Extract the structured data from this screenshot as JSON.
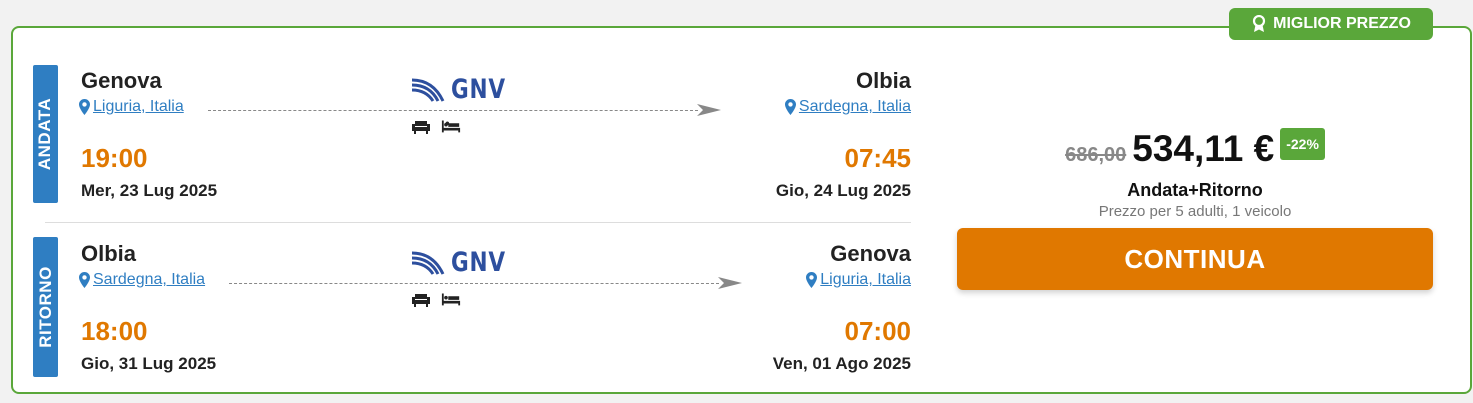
{
  "badge": {
    "label": "MIGLIOR PREZZO",
    "icon": "award-ribbon-icon"
  },
  "legs": [
    {
      "tag": "ANDATA",
      "from": {
        "city": "Genova",
        "region": "Liguria, Italia",
        "time": "19:00",
        "date": "Mer, 23 Lug 2025"
      },
      "to": {
        "city": "Olbia",
        "region": "Sardegna, Italia",
        "time": "07:45",
        "date": "Gio, 24 Lug 2025"
      },
      "operator": "GNV",
      "amenities": [
        "armchair-icon",
        "bed-icon"
      ]
    },
    {
      "tag": "RITORNO",
      "from": {
        "city": "Olbia",
        "region": "Sardegna, Italia",
        "time": "18:00",
        "date": "Gio, 31 Lug 2025"
      },
      "to": {
        "city": "Genova",
        "region": "Liguria, Italia",
        "time": "07:00",
        "date": "Ven, 01 Ago 2025"
      },
      "operator": "GNV",
      "amenities": [
        "armchair-icon",
        "bed-icon"
      ]
    }
  ],
  "price": {
    "old": "686,00",
    "new": "534,11 €",
    "discount": "-22%",
    "trip_type": "Andata+Ritorno",
    "pax_info": "Prezzo per 5 adulti, 1 veicolo"
  },
  "cta": {
    "label": "CONTINUA"
  },
  "colors": {
    "accent_green": "#5aa73a",
    "orange": "#e07800",
    "blue": "#2f7ec2",
    "operator_blue": "#2d4f9e"
  }
}
